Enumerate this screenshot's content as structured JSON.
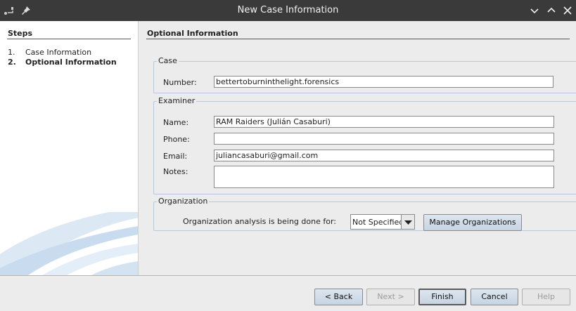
{
  "window": {
    "title": "New Case Information"
  },
  "steps": {
    "title": "Steps",
    "items": [
      {
        "num": "1.",
        "label": "Case Information"
      },
      {
        "num": "2.",
        "label": "Optional Information"
      }
    ]
  },
  "panel": {
    "title": "Optional Information",
    "case": {
      "legend": "Case",
      "number_label": "Number:",
      "number_value": "bettertoburninthelight.forensics"
    },
    "examiner": {
      "legend": "Examiner",
      "name_label": "Name:",
      "name_value": "RAM Raiders (Julián Casaburi)",
      "phone_label": "Phone:",
      "phone_value": "",
      "email_label": "Email:",
      "email_value": "juliancasaburi@gmail.com",
      "notes_label": "Notes:",
      "notes_value": ""
    },
    "organization": {
      "legend": "Organization",
      "prompt": "Organization analysis is being done for:",
      "selected": "Not Specified",
      "manage_label": "Manage Organizations"
    }
  },
  "footer": {
    "back": "< Back",
    "next": "Next >",
    "finish": "Finish",
    "cancel": "Cancel",
    "help": "Help"
  }
}
